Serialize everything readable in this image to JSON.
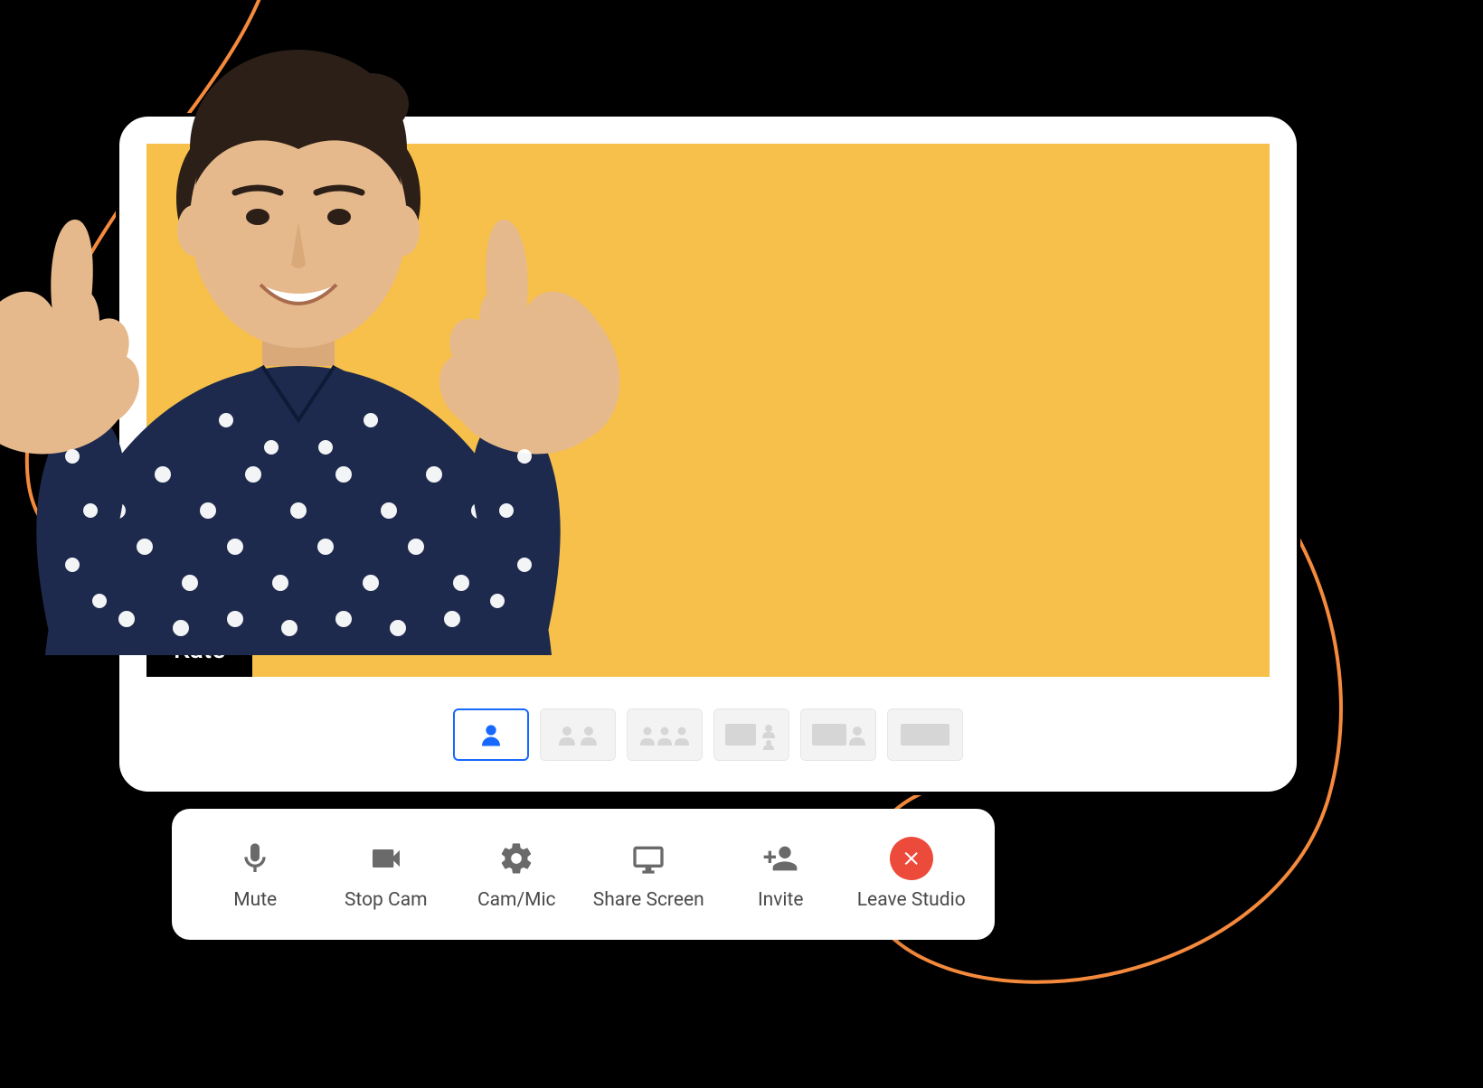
{
  "participant": {
    "name": "Kate"
  },
  "layouts": {
    "selected_index": 0,
    "options": [
      "single",
      "two-up",
      "three-up",
      "main-two",
      "main-one",
      "full"
    ]
  },
  "toolbar": {
    "mute_label": "Mute",
    "stop_cam_label": "Stop Cam",
    "cam_mic_label": "Cam/Mic",
    "share_screen_label": "Share Screen",
    "invite_label": "Invite",
    "leave_label": "Leave Studio"
  },
  "colors": {
    "accent": "#1668ff",
    "video_bg": "#f7c04a",
    "swirl": "#f58a3c",
    "leave": "#ec4a3a"
  }
}
